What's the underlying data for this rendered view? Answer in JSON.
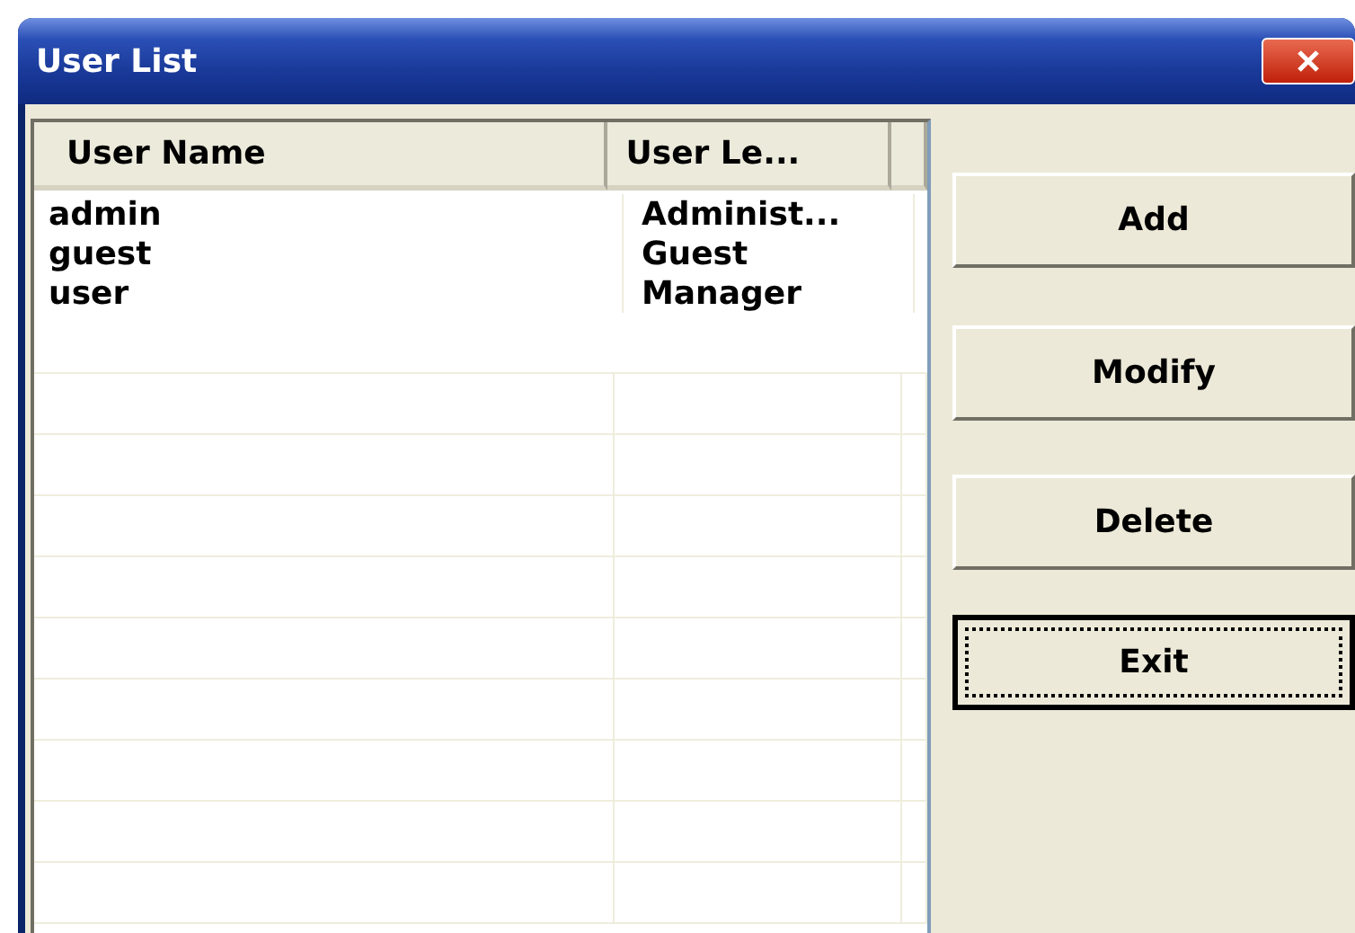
{
  "window": {
    "title": "User List"
  },
  "table": {
    "columns": [
      "User Name",
      "User Le..."
    ],
    "rows": [
      {
        "cells": [
          "admin",
          "Administ..."
        ]
      },
      {
        "cells": [
          "guest",
          "Guest"
        ]
      },
      {
        "cells": [
          "user",
          "Manager"
        ]
      }
    ]
  },
  "buttons": [
    {
      "label": "Add",
      "focused": false
    },
    {
      "label": "Modify",
      "focused": false
    },
    {
      "label": "Delete",
      "focused": false
    },
    {
      "label": "Exit",
      "focused": true
    }
  ]
}
